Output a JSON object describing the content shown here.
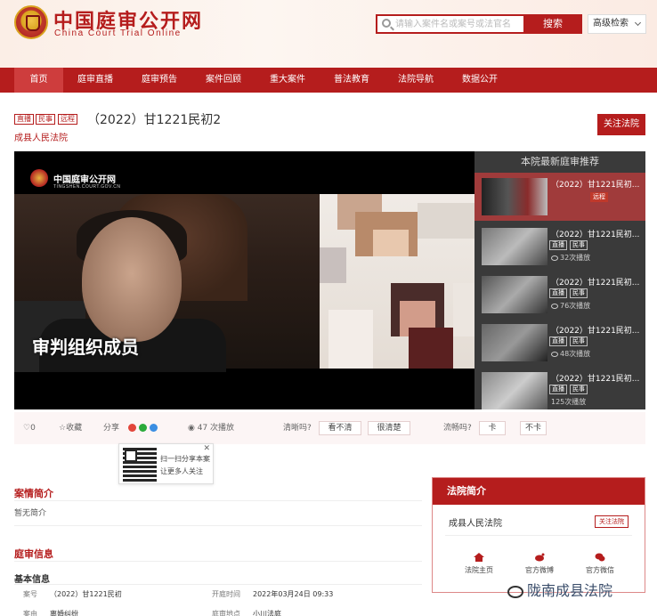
{
  "header": {
    "title_cn": "中国庭审公开网",
    "title_en": "China Court Trial Online",
    "search_placeholder": "请输入案件名或案号或法官名",
    "search_button": "搜索",
    "advanced_search": "高级检索"
  },
  "nav": {
    "items": [
      "首页",
      "庭审直播",
      "庭审预告",
      "案件回顾",
      "重大案件",
      "普法教育",
      "法院导航",
      "数据公开"
    ],
    "active_index": 0
  },
  "case": {
    "tags": [
      "直播",
      "民事",
      "远程"
    ],
    "title": "（2022）甘1221民初2",
    "court": "成县人民法院",
    "follow_court": "关注法院"
  },
  "video": {
    "logo_cn": "中国庭审公开网",
    "logo_en": "TINGSHEN.COURT.GOV.CN",
    "caption": "审判组织成员"
  },
  "recommendations": {
    "header": "本院最新庭审推荐",
    "items": [
      {
        "title": "（2022）甘1221民初...",
        "tags": [
          "远程"
        ],
        "plays": ""
      },
      {
        "title": "（2022）甘1221民初...",
        "tags": [
          "直播",
          "民事"
        ],
        "plays": "32次播放"
      },
      {
        "title": "（2022）甘1221民初...",
        "tags": [
          "直播",
          "民事"
        ],
        "plays": "76次播放"
      },
      {
        "title": "（2022）甘1221民初...",
        "tags": [
          "直播",
          "民事"
        ],
        "plays": "48次播放"
      },
      {
        "title": "（2022）甘1221民初...",
        "tags": [
          "直播",
          "民事"
        ],
        "plays": "125次播放"
      }
    ]
  },
  "action_bar": {
    "likes": "0",
    "favorite": "收藏",
    "share": "分享",
    "plays": "47 次播放",
    "clarity_question": "清晰吗?",
    "unclear": "看不清",
    "clear": "很清楚",
    "smooth_question": "流畅吗?",
    "lag": "卡",
    "no_lag": "不卡"
  },
  "qr_popup": {
    "line1": "扫一扫分享本案",
    "line2": "让更多人关注"
  },
  "case_intro": {
    "title": "案情简介",
    "content": "暂无简介"
  },
  "trial_info": {
    "title": "庭审信息",
    "subtitle": "基本信息",
    "case_no_label": "案号",
    "case_no": "（2022）甘1221民初",
    "open_time_label": "开庭时间",
    "open_time": "2022年03月24日 09:33",
    "cause_label": "案由",
    "cause": "离婚纠纷",
    "location_label": "庭审地点",
    "location": "小川法庭"
  },
  "court_intro": {
    "title": "法院简介",
    "court_name": "成县人民法院",
    "follow": "关注法院",
    "links": [
      "法院主页",
      "官方微博",
      "官方微信"
    ]
  },
  "watermark": "陇南成县法院",
  "colors": {
    "brand_red": "#b51d1d",
    "nav_active": "#ce3d3d",
    "rec_panel_bg": "#3a3a3a",
    "rec_active": "#a03b3b"
  }
}
